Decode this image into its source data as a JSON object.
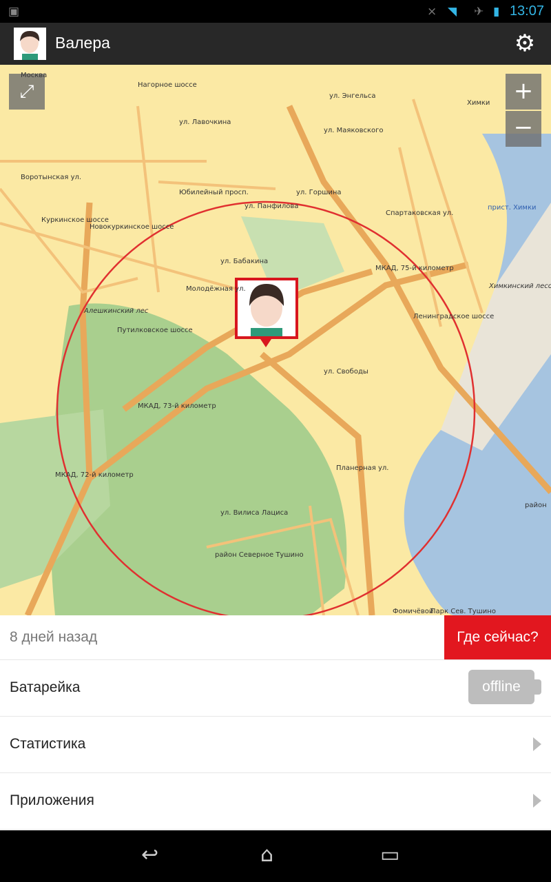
{
  "status_bar": {
    "time": "13:07",
    "icons": [
      "image-notification-icon",
      "mute-icon",
      "wifi-icon",
      "airplane-icon",
      "battery-icon"
    ]
  },
  "action_bar": {
    "title": "Валера",
    "settings_icon": "gear-icon"
  },
  "map": {
    "controls": {
      "fullscreen_icon": "expand-icon",
      "zoom_in": "+",
      "zoom_out": "−"
    },
    "accuracy_circle_color": "#e03030",
    "labels": [
      "Нагорное шоссе",
      "ул. Лавочкина",
      "Юбилейный просп.",
      "Воротынская ул.",
      "Куркинское шоссе",
      "Новокуркинское шоссе",
      "ул. Бабакина",
      "Молодёжная ул.",
      "Алешкинский лес",
      "Путилковское шоссе",
      "МКАД, 73-й километр",
      "МКАД, 75-й километр",
      "МКАД, 72-й километр",
      "ул. Свободы",
      "Ленинградское шоссе",
      "Планерная ул.",
      "ул. Вилиса Лациса",
      "район Северное Тушино",
      "Химки",
      "прист. Химки",
      "Химкинский лесопарк",
      "ул. Горшина",
      "ул. Панфилова",
      "ул. Маяковского",
      "ул. Энгельса",
      "Спартаковская ул.",
      "Москва",
      "Парк Сев. Тушино",
      "Фомичёвой",
      "район"
    ]
  },
  "panel": {
    "last_seen": "8 дней назад",
    "where_now_button": "Где сейчас?",
    "battery_label": "Батарейка",
    "battery_status": "offline",
    "statistics_label": "Статистика",
    "apps_label": "Приложения"
  },
  "colors": {
    "accent": "#e2171f",
    "action_bar": "#282828",
    "status_text": "#33b5e5"
  }
}
